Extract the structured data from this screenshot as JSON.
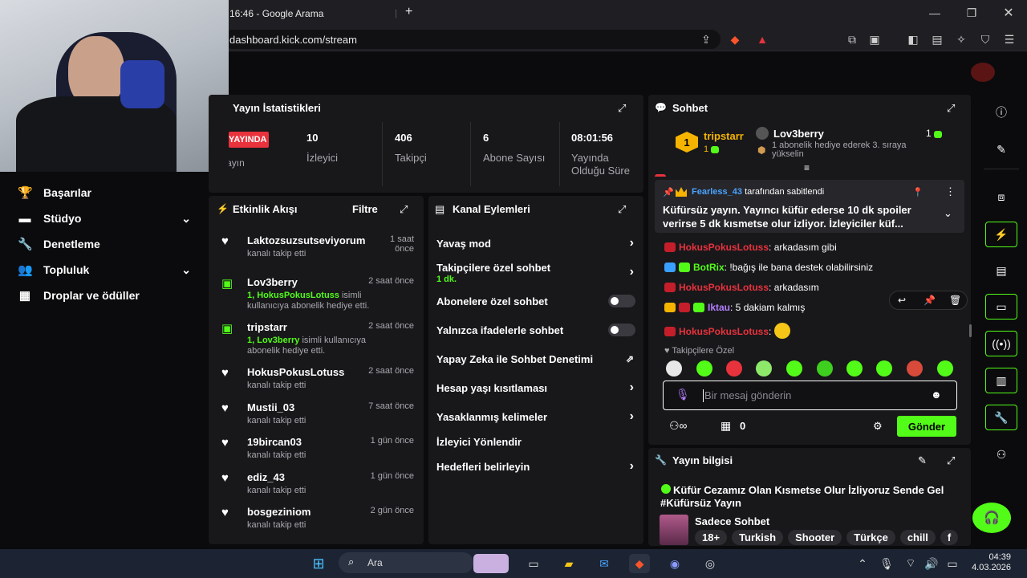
{
  "browser": {
    "tab_title": "16:46 - Google Arama",
    "url": "dashboard.kick.com/stream",
    "new_tab": "+",
    "window_controls": [
      "minimize",
      "maximize",
      "close"
    ]
  },
  "left_nav": {
    "items": [
      {
        "label": "Başarılar",
        "icon": "trophy-icon"
      },
      {
        "label": "Stüdyo",
        "icon": "studio-icon",
        "expandable": true
      },
      {
        "label": "Denetleme",
        "icon": "wrench-icon"
      },
      {
        "label": "Topluluk",
        "icon": "community-icon",
        "expandable": true
      },
      {
        "label": "Droplar ve ödüller",
        "icon": "gift-icon"
      }
    ]
  },
  "stats": {
    "title": "Yayın İstatistikleri",
    "live_badge": "YAYINDA",
    "live_sub": "Yayın",
    "items": [
      {
        "value": "10",
        "label": "İzleyici"
      },
      {
        "value": "406",
        "label": "Takipçi"
      },
      {
        "value": "6",
        "label": "Abone Sayısı"
      },
      {
        "value": "08:01:56",
        "label": "Yayında Olduğu Süre"
      }
    ]
  },
  "activity": {
    "title": "Etkinlik Akışı",
    "filter": "Filtre",
    "items": [
      {
        "name": "Laktozsuzsutseviyorum",
        "sub": "kanalı takip etti",
        "time": "1 saat önce",
        "type": "follow"
      },
      {
        "name": "Lov3berry",
        "sub_green": "1, HokusPokusLotuss",
        "sub": "isimli kullanıcıya abonelik hediye etti.",
        "time": "2 saat önce",
        "type": "gift"
      },
      {
        "name": "tripstarr",
        "sub_green": "1, Lov3berry",
        "sub": "isimli kullanıcıya abonelik hediye etti.",
        "time": "2 saat önce",
        "type": "gift"
      },
      {
        "name": "HokusPokusLotuss",
        "sub": "kanalı takip etti",
        "time": "2 saat önce",
        "type": "follow"
      },
      {
        "name": "Mustii_03",
        "sub": "kanalı takip etti",
        "time": "7 saat önce",
        "type": "follow"
      },
      {
        "name": "19bircan03",
        "sub": "kanalı takip etti",
        "time": "1 gün önce",
        "type": "follow"
      },
      {
        "name": "ediz_43",
        "sub": "kanalı takip etti",
        "time": "1 gün önce",
        "type": "follow"
      },
      {
        "name": "bosgeziniom",
        "sub": "kanalı takip etti",
        "time": "2 gün önce",
        "type": "follow"
      }
    ]
  },
  "channel_actions": {
    "title": "Kanal Eylemleri",
    "items": [
      {
        "label": "Yavaş mod",
        "control": "chevron"
      },
      {
        "label": "Takipçilere özel sohbet",
        "sub": "1 dk.",
        "control": "chevron"
      },
      {
        "label": "Abonelere özel sohbet",
        "control": "toggle"
      },
      {
        "label": "Yalnızca ifadelerle sohbet",
        "control": "toggle"
      },
      {
        "label": "Yapay Zeka ile Sohbet Denetimi",
        "control": "external"
      },
      {
        "label": "Hesap yaşı kısıtlaması",
        "control": "chevron"
      },
      {
        "label": "Yasaklanmış kelimeler",
        "control": "chevron"
      },
      {
        "label": "İzleyici Yönlendir",
        "control": "none"
      },
      {
        "label": "Hedefleri belirleyin",
        "control": "chevron"
      }
    ]
  },
  "chat": {
    "title": "Sohbet",
    "leader1": {
      "rank": "1",
      "name": "tripstarr",
      "count": "1"
    },
    "leader2": {
      "name": "Lov3berry",
      "count": "1",
      "sub": "1 abonelik hediye ederek 3. sıraya yükselin"
    },
    "pinned": {
      "by": "Fearless_43",
      "by_suffix": "tarafından sabitlendi",
      "text": "Küfürsüz yayın. Yayıncı küfür ederse 10 dk spoiler verirse 5 dk kısmetse olur izliyor. İzleyiciler küf..."
    },
    "messages": [
      {
        "user": "HokusPokusLotuss",
        "color": "red",
        "text": ": arkadasım gibi"
      },
      {
        "user": "BotRix",
        "color": "green",
        "text": ": !bağış ile bana destek olabilirsiniz"
      },
      {
        "user": "HokusPokusLotuss",
        "color": "red",
        "text": ": arkadasım"
      },
      {
        "user": "Iktau",
        "color": "purple",
        "text": ": 5 dakiam kalmış"
      },
      {
        "user": "HokusPokusLotuss",
        "color": "red",
        "text": ": "
      }
    ],
    "followers_only": "Takipçilere Özel",
    "input_placeholder": "Bir mesaj gönderin",
    "points": "0",
    "send": "Gönder"
  },
  "stream_info": {
    "title": "Yayın bilgisi",
    "stream_title": "Küfür Cezamız Olan Kısmetse Olur İzliyoruz Sende Gel #Küfürsüz Yayın",
    "category": "Sadece Sohbet",
    "tags": [
      "18+",
      "Turkish",
      "Shooter",
      "Türkçe",
      "chill",
      "f"
    ]
  },
  "taskbar": {
    "search": "Ara",
    "time": "04:39",
    "date": "4.03.2026"
  },
  "colors": {
    "accent": "#53fc18",
    "live": "#e8323c",
    "panel": "#18181b"
  }
}
